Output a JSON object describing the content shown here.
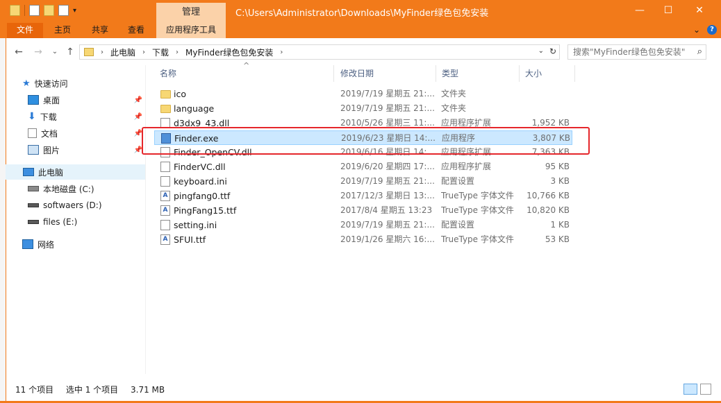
{
  "window": {
    "title": "C:\\Users\\Administrator\\Downloads\\MyFinder绿色包免安装",
    "context_tab": "管理",
    "controls": [
      "—",
      "☐",
      "✕"
    ]
  },
  "ribbon": {
    "tabs": [
      "文件",
      "主页",
      "共享",
      "查看",
      "应用程序工具"
    ],
    "collapse": "⌄",
    "help": "?"
  },
  "address": {
    "crumbs": [
      "此电脑",
      "下载",
      "MyFinder绿色包免安装"
    ],
    "search_placeholder": "搜索\"MyFinder绿色包免安装\""
  },
  "sidebar": {
    "items": [
      {
        "label": "快速访问",
        "icon": "star-icon"
      },
      {
        "label": "桌面",
        "icon": "desktop-icon",
        "pinned": true
      },
      {
        "label": "下载",
        "icon": "download-icon",
        "pinned": true
      },
      {
        "label": "文档",
        "icon": "document-icon",
        "pinned": true
      },
      {
        "label": "图片",
        "icon": "picture-icon",
        "pinned": true
      },
      {
        "label": "此电脑",
        "icon": "computer-icon",
        "selected": true
      },
      {
        "label": "本地磁盘 (C:)",
        "icon": "drive-icon"
      },
      {
        "label": "softwaers (D:)",
        "icon": "drive-icon"
      },
      {
        "label": "files (E:)",
        "icon": "drive-icon"
      },
      {
        "label": "网络",
        "icon": "network-icon"
      }
    ]
  },
  "columns": [
    "名称",
    "修改日期",
    "类型",
    "大小"
  ],
  "files": [
    {
      "name": "ico",
      "date": "2019/7/19 星期五 21:...",
      "type": "文件夹",
      "size": "",
      "icon": "folder"
    },
    {
      "name": "language",
      "date": "2019/7/19 星期五 21:...",
      "type": "文件夹",
      "size": "",
      "icon": "folder"
    },
    {
      "name": "d3dx9_43.dll",
      "date": "2010/5/26 星期三 11:...",
      "type": "应用程序扩展",
      "size": "1,952 KB",
      "icon": "doc"
    },
    {
      "name": "Finder.exe",
      "date": "2019/6/23 星期日 14:...",
      "type": "应用程序",
      "size": "3,807 KB",
      "icon": "exe",
      "selected": true
    },
    {
      "name": "Finder_OpenCV.dll",
      "date": "2019/6/16 星期日 14:...",
      "type": "应用程序扩展",
      "size": "7,363 KB",
      "icon": "doc"
    },
    {
      "name": "FinderVC.dll",
      "date": "2019/6/20 星期四 17:...",
      "type": "应用程序扩展",
      "size": "95 KB",
      "icon": "doc"
    },
    {
      "name": "keyboard.ini",
      "date": "2019/7/19 星期五 21:...",
      "type": "配置设置",
      "size": "3 KB",
      "icon": "doc"
    },
    {
      "name": "pingfang0.ttf",
      "date": "2017/12/3 星期日 13:...",
      "type": "TrueType 字体文件",
      "size": "10,766 KB",
      "icon": "font"
    },
    {
      "name": "PingFang15.ttf",
      "date": "2017/8/4 星期五 13:23",
      "type": "TrueType 字体文件",
      "size": "10,820 KB",
      "icon": "font"
    },
    {
      "name": "setting.ini",
      "date": "2019/7/19 星期五 21:...",
      "type": "配置设置",
      "size": "1 KB",
      "icon": "doc"
    },
    {
      "name": "SFUI.ttf",
      "date": "2019/1/26 星期六 16:...",
      "type": "TrueType 字体文件",
      "size": "53 KB",
      "icon": "font"
    }
  ],
  "status": {
    "count": "11 个项目",
    "selection": "选中 1 个项目",
    "size": "3.71 MB"
  },
  "colors": {
    "titlebar": "#f27a1a",
    "selection": "#cce8ff",
    "highlight_box": "#e5262b"
  }
}
